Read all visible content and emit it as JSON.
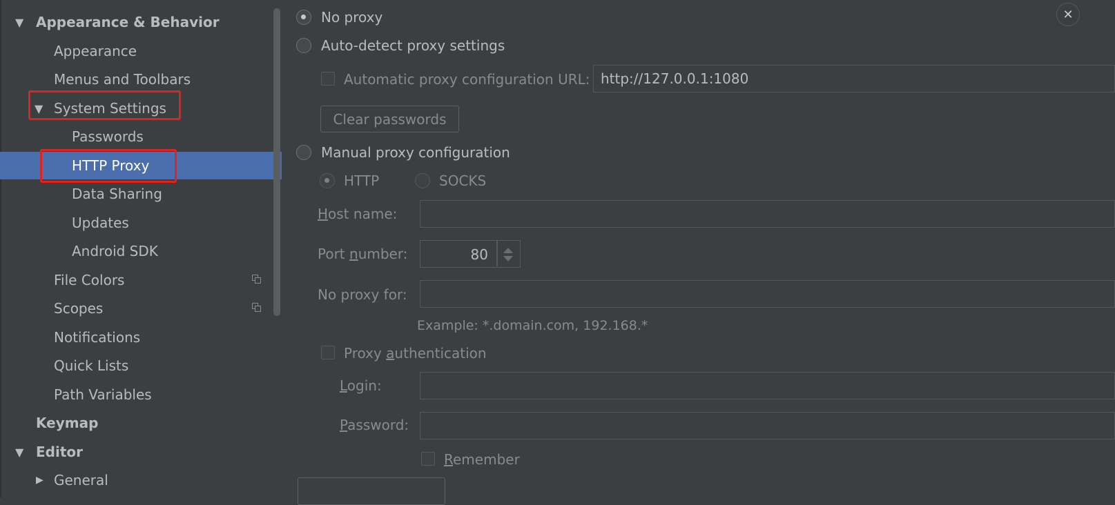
{
  "sidebar": {
    "items": [
      {
        "label": "Appearance & Behavior",
        "level": 0,
        "expanded": true,
        "bold": true
      },
      {
        "label": "Appearance",
        "level": 1
      },
      {
        "label": "Menus and Toolbars",
        "level": 1
      },
      {
        "label": "System Settings",
        "level": 1,
        "expanded": true
      },
      {
        "label": "Passwords",
        "level": 2
      },
      {
        "label": "HTTP Proxy",
        "level": 2,
        "selected": true
      },
      {
        "label": "Data Sharing",
        "level": 2
      },
      {
        "label": "Updates",
        "level": 2
      },
      {
        "label": "Android SDK",
        "level": 2
      },
      {
        "label": "File Colors",
        "level": 1,
        "icon": "copy-icon"
      },
      {
        "label": "Scopes",
        "level": 1,
        "icon": "copy-icon"
      },
      {
        "label": "Notifications",
        "level": 1
      },
      {
        "label": "Quick Lists",
        "level": 1
      },
      {
        "label": "Path Variables",
        "level": 1
      },
      {
        "label": "Keymap",
        "level": 0,
        "bold": true
      },
      {
        "label": "Editor",
        "level": 0,
        "expanded": true,
        "bold": true
      },
      {
        "label": "General",
        "level": 1,
        "collapsed": true
      }
    ],
    "highlight_color": "#e3211d",
    "selected_color": "#4b6eaf"
  },
  "proxy": {
    "no_proxy": "No proxy",
    "auto_detect": "Auto-detect proxy settings",
    "auto_config_url_label": "Automatic proxy configuration URL:",
    "auto_config_url_value": "http://127.0.0.1:1080",
    "clear_passwords": "Clear passwords",
    "manual": "Manual proxy configuration",
    "http": "HTTP",
    "socks": "SOCKS",
    "host_name_u": "H",
    "host_name_rest": "ost name:",
    "port_pre": "Port ",
    "port_u": "n",
    "port_post": "umber:",
    "port_value": "80",
    "no_proxy_for": "No proxy for:",
    "example": "Example: *.domain.com, 192.168.*",
    "proxy_auth_pre": "Proxy ",
    "proxy_auth_u": "a",
    "proxy_auth_post": "uthentication",
    "login_u": "L",
    "login_rest": "ogin:",
    "password_u": "P",
    "password_rest": "assword:",
    "remember_u": "R",
    "remember_rest": "emember",
    "selected_option": "No proxy"
  },
  "window": {
    "close_glyph": "✕"
  }
}
